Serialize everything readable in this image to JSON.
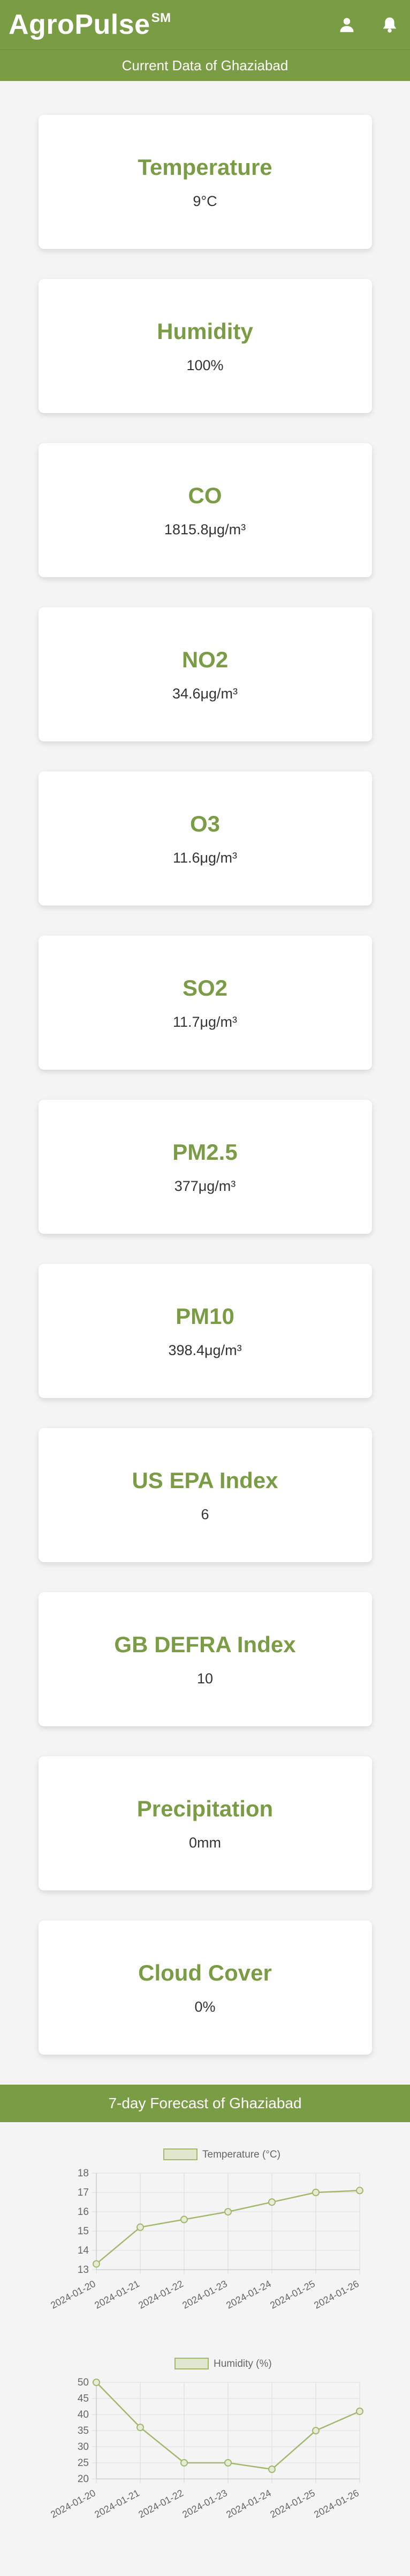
{
  "header": {
    "brand": "AgroPulse",
    "brand_mark": "SM"
  },
  "subheader": "Current Data of Ghaziabad",
  "cards": [
    {
      "title": "Temperature",
      "value": "9°C"
    },
    {
      "title": "Humidity",
      "value": "100%"
    },
    {
      "title": "CO",
      "value": "1815.8μg/m³"
    },
    {
      "title": "NO2",
      "value": "34.6μg/m³"
    },
    {
      "title": "O3",
      "value": "11.6μg/m³"
    },
    {
      "title": "SO2",
      "value": "11.7μg/m³"
    },
    {
      "title": "PM2.5",
      "value": "377μg/m³"
    },
    {
      "title": "PM10",
      "value": "398.4μg/m³"
    },
    {
      "title": "US EPA Index",
      "value": "6"
    },
    {
      "title": "GB DEFRA Index",
      "value": "10"
    },
    {
      "title": "Precipitation",
      "value": "0mm"
    },
    {
      "title": "Cloud Cover",
      "value": "0%"
    }
  ],
  "forecast_title": "7-day Forecast of Ghaziabad",
  "colors": {
    "accent": "#7a9c45",
    "line": "#a3b86c"
  },
  "icons": [
    "user-icon",
    "bell-icon"
  ],
  "chart_data": [
    {
      "type": "line",
      "x": [
        "2024-01-20",
        "2024-01-21",
        "2024-01-22",
        "2024-01-23",
        "2024-01-24",
        "2024-01-25",
        "2024-01-26"
      ],
      "series": [
        {
          "name": "Temperature (°C)",
          "values": [
            13.3,
            15.2,
            15.6,
            16.0,
            16.5,
            17.0,
            17.1
          ]
        }
      ],
      "ylim": [
        13,
        18
      ],
      "yticks": [
        13,
        14,
        15,
        16,
        17,
        18
      ],
      "legend": "top-center",
      "grid": true
    },
    {
      "type": "line",
      "x": [
        "2024-01-20",
        "2024-01-21",
        "2024-01-22",
        "2024-01-23",
        "2024-01-24",
        "2024-01-25",
        "2024-01-26"
      ],
      "series": [
        {
          "name": "Humidity (%)",
          "values": [
            50,
            36,
            25,
            25,
            23,
            35,
            41
          ]
        }
      ],
      "ylim": [
        20,
        50
      ],
      "yticks": [
        20,
        25,
        30,
        35,
        40,
        45,
        50
      ],
      "legend": "top-center",
      "grid": true
    }
  ]
}
